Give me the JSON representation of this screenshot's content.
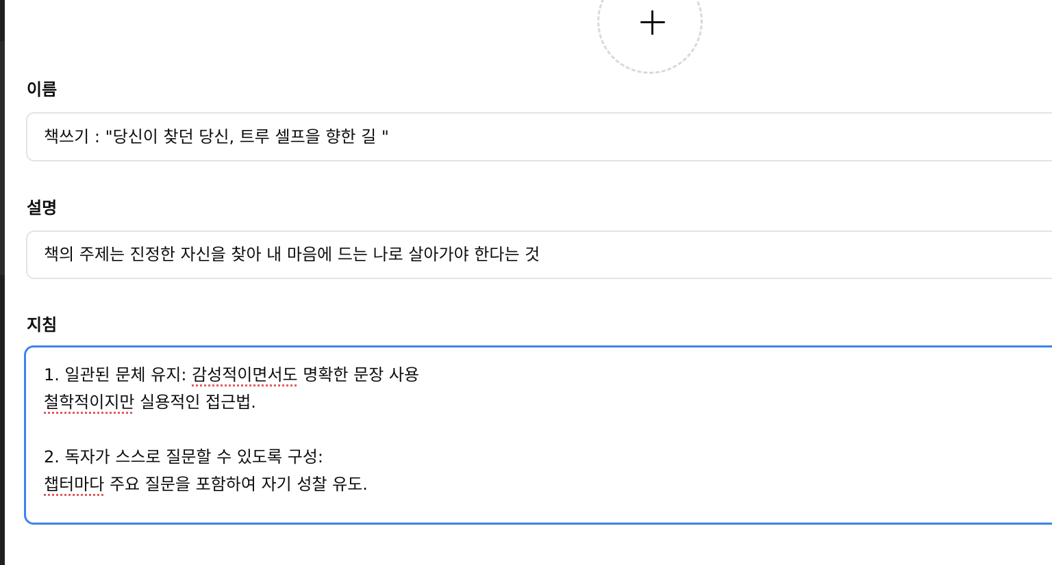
{
  "avatar": {
    "icon": "plus-icon"
  },
  "name_field": {
    "label": "이름",
    "value": "책쓰기 : \"당신이 찾던 당신, 트루 셀프을 향한 길 \""
  },
  "description_field": {
    "label": "설명",
    "value": "책의 주제는 진정한 자신을 찾아 내 마음에 드는 나로 살아가야 한다는 것"
  },
  "instructions_field": {
    "label": "지침",
    "lines": [
      {
        "pre": "1. 일관된 문체 유지: ",
        "marked": "감성적이면서도",
        "post": " 명확한 문장 사용"
      },
      {
        "pre": "",
        "marked": "철학적이지만",
        "post": " 실용적인 접근법."
      },
      {
        "pre": "",
        "marked": "",
        "post": ""
      },
      {
        "pre": "2. 독자가 스스로 질문할 수 있도록 구성:",
        "marked": "",
        "post": ""
      },
      {
        "pre": "",
        "marked": "챕터마다",
        "post": " 주요 질문을 포함하여 자기 성찰 유도."
      }
    ],
    "accent_color": "#3b82f0",
    "spellcheck_color": "#e05a5a"
  }
}
